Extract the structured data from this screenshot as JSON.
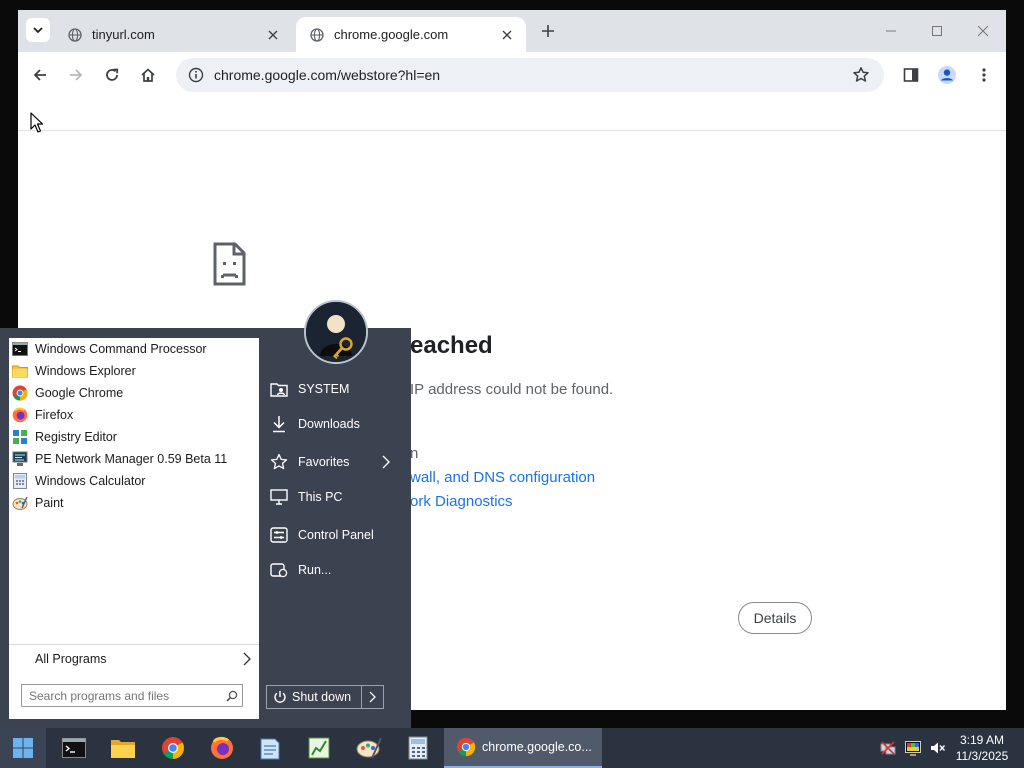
{
  "browser": {
    "tabs": [
      {
        "label": "tinyurl.com",
        "active": false
      },
      {
        "label": "chrome.google.com",
        "active": true
      }
    ],
    "address": "chrome.google.com/webstore?hl=en",
    "error": {
      "title": "eached",
      "subtitle": "IP address could not be found.",
      "try_text": "n",
      "links": [
        "wall, and DNS configuration",
        "ork Diagnostics"
      ],
      "details_label": "Details"
    }
  },
  "start_menu": {
    "programs": [
      {
        "label": "Windows Command Processor",
        "icon": "cmd-icon"
      },
      {
        "label": "Windows Explorer",
        "icon": "folder-icon"
      },
      {
        "label": "Google Chrome",
        "icon": "chrome-icon"
      },
      {
        "label": "Firefox",
        "icon": "firefox-icon"
      },
      {
        "label": "Registry Editor",
        "icon": "registry-icon"
      },
      {
        "label": "PE Network Manager 0.59 Beta 11",
        "icon": "network-icon"
      },
      {
        "label": "Windows Calculator",
        "icon": "calculator-icon"
      },
      {
        "label": "Paint",
        "icon": "paint-icon"
      }
    ],
    "all_programs_label": "All Programs",
    "search_placeholder": "Search programs and files",
    "places": [
      {
        "label": "SYSTEM",
        "icon": "user-folder-icon"
      },
      {
        "label": "Downloads",
        "icon": "download-icon"
      },
      {
        "label": "Favorites",
        "icon": "star-icon"
      },
      {
        "label": "This PC",
        "icon": "computer-icon"
      },
      {
        "label": "Control Panel",
        "icon": "control-panel-icon"
      },
      {
        "label": "Run...",
        "icon": "run-icon"
      }
    ],
    "shutdown_label": "Shut down"
  },
  "taskbar": {
    "active_task_label": "chrome.google.co...",
    "pinned": [
      "cmd-icon",
      "folder-icon",
      "chrome-icon",
      "firefox-icon",
      "notepad-icon",
      "registry-icon",
      "paint-icon",
      "calculator-icon"
    ],
    "clock_time": "3:19 AM",
    "clock_date": "11/3/2025"
  },
  "colors": {
    "tabstrip": "#dfe3e8",
    "omnibox": "#edf0f5",
    "link": "#1a73e8",
    "startmenu": "#3b4250",
    "taskbar": "#2b3341"
  }
}
